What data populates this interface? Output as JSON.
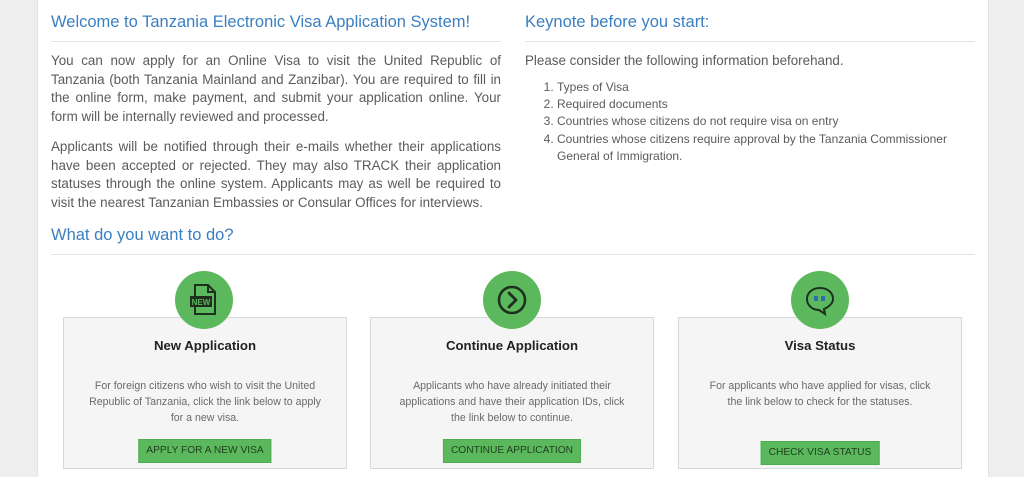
{
  "welcome": {
    "title": "Welcome to Tanzania Electronic Visa Application System!",
    "para1": "You can now apply for an Online Visa to visit the United Republic of Tanzania (both Tanzania Mainland and Zanzibar). You are required to fill in the online form, make payment, and submit your application online. Your form will be internally reviewed and processed.",
    "para2": "Applicants will be notified through their e-mails whether their applications have been accepted or rejected. They may also TRACK their application statuses through the online system. Applicants may as well be required to visit the nearest Tanzanian Embassies or Consular Offices for interviews."
  },
  "keynote": {
    "title": "Keynote before you start:",
    "intro": "Please consider the following information beforehand.",
    "items": [
      "Types of Visa",
      "Required documents",
      "Countries whose citizens do not require visa on entry",
      "Countries whose citizens require approval by the Tanzania Commissioner General of Immigration."
    ]
  },
  "actions": {
    "title": "What do you want to do?",
    "cards": [
      {
        "icon": "new-document-icon",
        "title": "New Application",
        "description": "For foreign citizens who wish to visit the United Republic of Tanzania, click the link below to apply for a new visa.",
        "button": "APPLY FOR A NEW VISA"
      },
      {
        "icon": "arrow-circle-right-icon",
        "title": "Continue Application",
        "description": "Applicants who have already initiated their applications and have their application IDs, click the link below to continue.",
        "button": "CONTINUE APPLICATION"
      },
      {
        "icon": "speech-bubble-icon",
        "title": "Visa Status",
        "description": "For applicants who have applied for visas, click the link below to check for the statuses.",
        "button": "CHECK VISA STATUS"
      }
    ]
  },
  "colors": {
    "heading_blue": "#3a7fc1",
    "button_green": "#5cb85c",
    "card_bg": "#f5f5f5"
  }
}
